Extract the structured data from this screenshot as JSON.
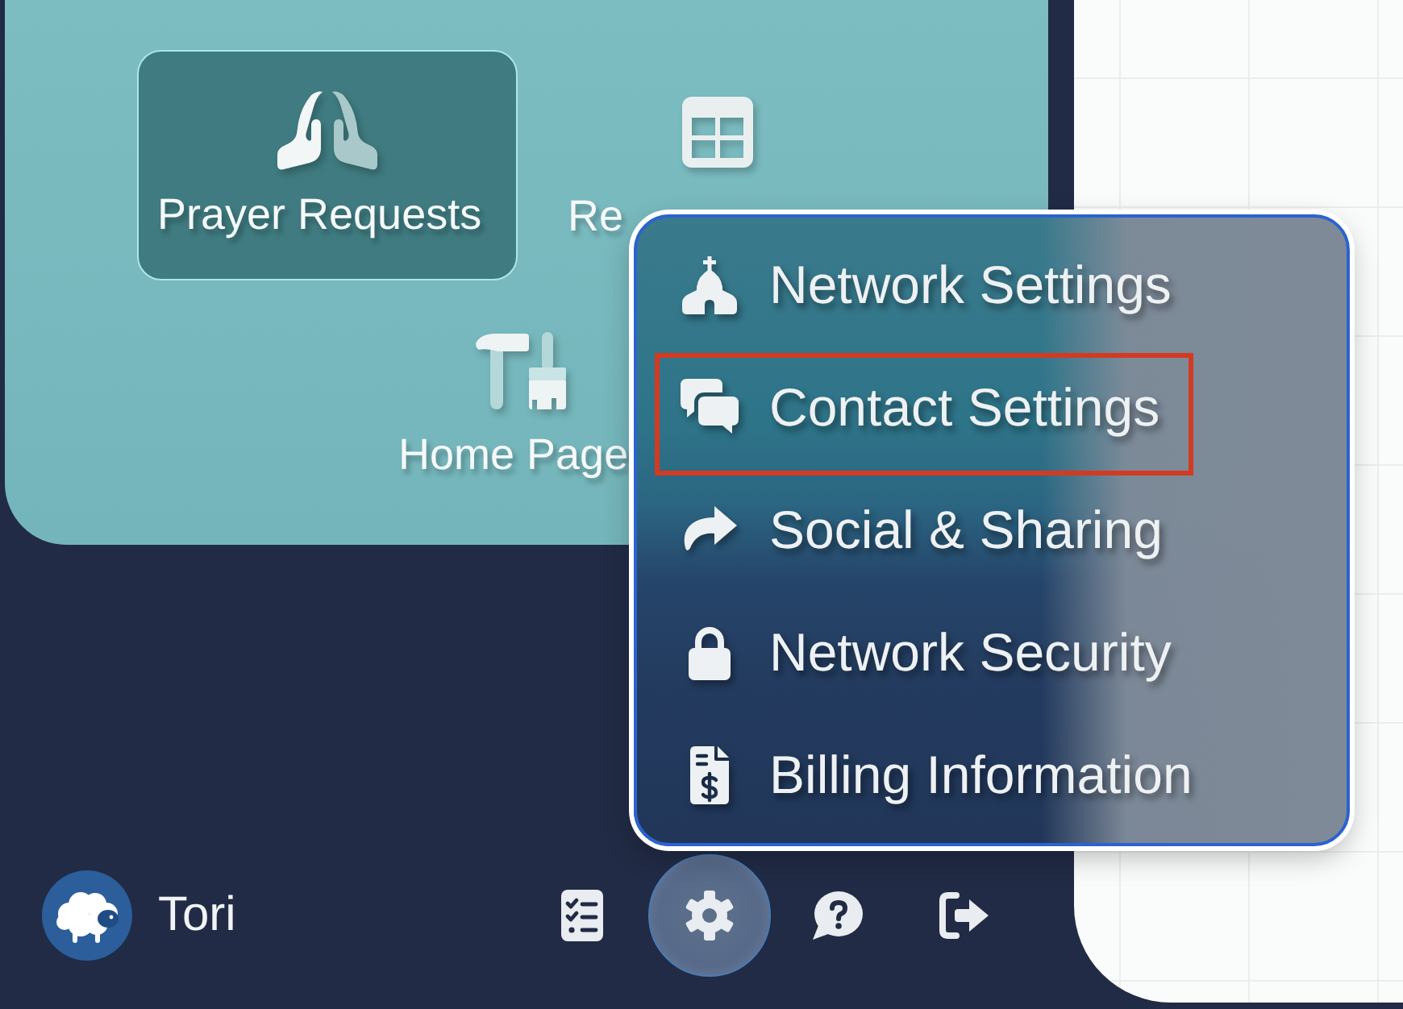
{
  "tiles": [
    {
      "label": "Prayer Requests",
      "selected": true
    },
    {
      "label": "Re",
      "selected": false
    },
    {
      "label": "Home Page",
      "selected": false
    }
  ],
  "menu": {
    "items": [
      {
        "label": "Network Settings",
        "highlighted": false
      },
      {
        "label": "Contact Settings",
        "highlighted": true
      },
      {
        "label": "Social & Sharing",
        "highlighted": false
      },
      {
        "label": "Network Security",
        "highlighted": false
      },
      {
        "label": "Billing Information",
        "highlighted": false
      }
    ]
  },
  "user": {
    "name": "Tori"
  },
  "toolbar": {
    "buttons": [
      {
        "expanded": false
      },
      {
        "expanded": true
      },
      {
        "expanded": false
      },
      {
        "expanded": false
      }
    ]
  }
}
